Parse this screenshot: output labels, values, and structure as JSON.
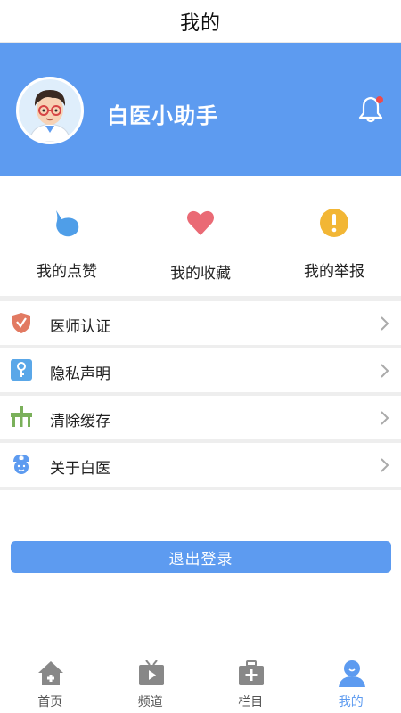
{
  "header": {
    "title": "我的"
  },
  "profile": {
    "username": "白医小助手",
    "bell_icon": "bell-icon",
    "notification_dot": true
  },
  "quick_actions": [
    {
      "label": "我的点赞",
      "icon": "like-icon"
    },
    {
      "label": "我的收藏",
      "icon": "heart-icon"
    },
    {
      "label": "我的举报",
      "icon": "exclamation-icon"
    }
  ],
  "menu": [
    {
      "label": "医师认证",
      "icon": "shield-check-icon"
    },
    {
      "label": "隐私声明",
      "icon": "key-icon"
    },
    {
      "label": "清除缓存",
      "icon": "broom-icon"
    },
    {
      "label": "关于白医",
      "icon": "nurse-icon"
    }
  ],
  "logout_label": "退出登录",
  "tabs": [
    {
      "label": "首页",
      "icon": "home-icon",
      "active": false
    },
    {
      "label": "频道",
      "icon": "tv-icon",
      "active": false
    },
    {
      "label": "栏目",
      "icon": "medical-kit-icon",
      "active": false
    },
    {
      "label": "我的",
      "icon": "user-icon",
      "active": true
    }
  ],
  "colors": {
    "primary": "#5d9bf0",
    "like": "#4f9ee8",
    "heart": "#ea6a75",
    "warning": "#f2b635",
    "doctor": "#e27a62",
    "privacy": "#5aa7e8",
    "cache": "#7ab05a",
    "about": "#5d9bf0",
    "tab_inactive": "#888888"
  }
}
